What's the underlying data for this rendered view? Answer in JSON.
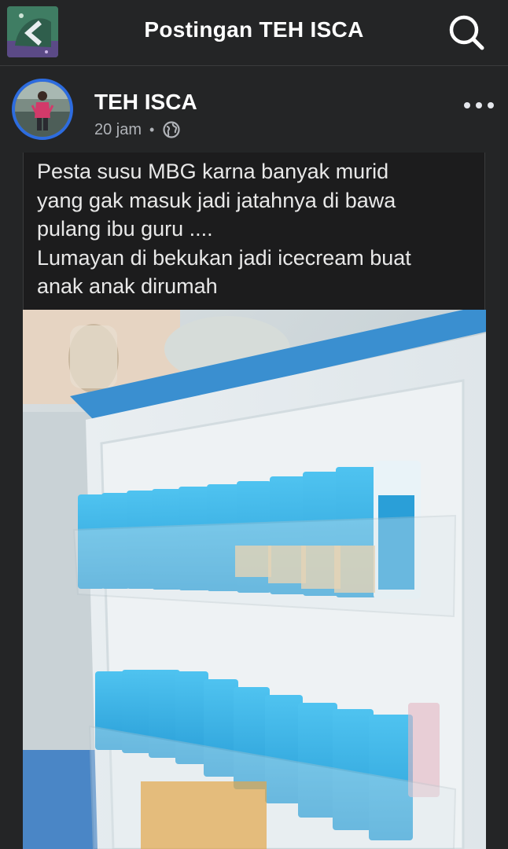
{
  "header": {
    "title": "Postingan TEH ISCA"
  },
  "post": {
    "author": "TEH ISCA",
    "time": "20 jam",
    "separator": "•",
    "text": "Pesta susu MBG karna banyak murid\nyang gak masuk jadi jatahnya di bawa\npulang ibu guru ....\nLumayan di bekukan jadi icecream buat\nanak anak dirumah"
  },
  "icons": {
    "back": "back-arrow-icon",
    "search": "search-icon",
    "more": "more-options-icon",
    "audience": "public-globe-icon"
  },
  "colors": {
    "background": "#242526",
    "avatar_ring": "#2d6cdf",
    "text_primary": "#ffffff",
    "text_secondary": "#b0b3b8"
  }
}
